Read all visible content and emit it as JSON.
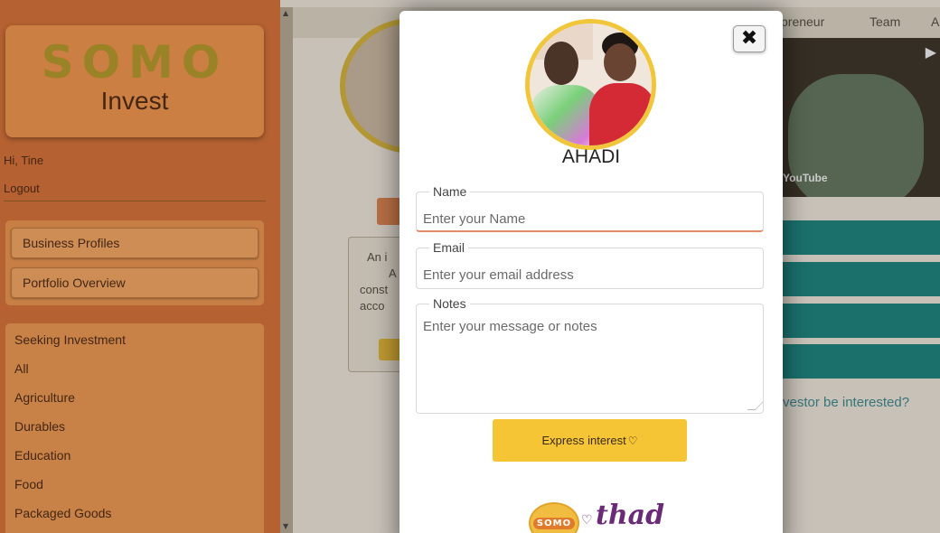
{
  "sidebar": {
    "logo_top": "SOMO",
    "logo_bottom": "Invest",
    "greeting": "Hi, Tine",
    "logout_label": "Logout",
    "nav": [
      {
        "label": "Business Profiles"
      },
      {
        "label": "Portfolio Overview"
      }
    ],
    "categories": [
      {
        "label": "Seeking Investment"
      },
      {
        "label": "All"
      },
      {
        "label": "Agriculture"
      },
      {
        "label": "Durables"
      },
      {
        "label": "Education"
      },
      {
        "label": "Food"
      },
      {
        "label": "Packaged Goods"
      }
    ]
  },
  "topbar": {
    "links": [
      {
        "label": "preneur"
      },
      {
        "label": "Team"
      },
      {
        "label": "A"
      }
    ]
  },
  "background_card": {
    "lines": [
      "An i",
      "A",
      "const",
      "acco"
    ]
  },
  "video": {
    "brand": "YouTube"
  },
  "investor_prompt": "vestor be interested?",
  "modal": {
    "company_name": "AHADI",
    "close_symbol": "✖",
    "fields": {
      "name": {
        "label": "Name",
        "placeholder": "Enter your Name"
      },
      "email": {
        "label": "Email",
        "placeholder": "Enter your email address"
      },
      "notes": {
        "label": "Notes",
        "placeholder": "Enter your message or notes"
      }
    },
    "submit_label": "Express interest",
    "submit_icon": "heart-outline-icon",
    "partner_logo_left": "SOMO",
    "partner_logo_right": "thad"
  },
  "colors": {
    "accent_yellow": "#f5c536",
    "sidebar_orange": "#c56a36",
    "teal": "#1e7a76",
    "partner_purple": "#6a2a78"
  }
}
